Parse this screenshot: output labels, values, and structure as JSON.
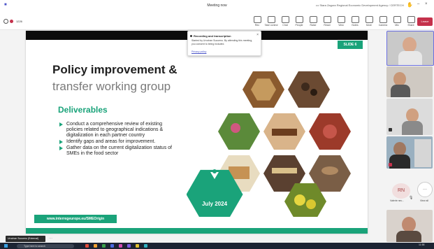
{
  "window": {
    "title": "Meeting now",
    "org": "•••  Stara Zagora Regional Economic Development Agency / CERTECH",
    "room_id": "1226"
  },
  "toolbar": {
    "buttons": [
      {
        "label": "Rec",
        "icon": "record-icon"
      },
      {
        "label": "Take control",
        "icon": "control-icon"
      },
      {
        "label": "Chat",
        "icon": "chat-icon"
      },
      {
        "label": "People",
        "icon": "people-icon"
      },
      {
        "label": "Raise",
        "icon": "raise-hand-icon"
      },
      {
        "label": "React",
        "icon": "react-icon"
      },
      {
        "label": "View",
        "icon": "view-icon"
      },
      {
        "label": "Notes",
        "icon": "notes-icon"
      },
      {
        "label": "More",
        "icon": "more-icon"
      },
      {
        "label": "Camera",
        "icon": "camera-icon"
      },
      {
        "label": "Mic",
        "icon": "mic-icon"
      },
      {
        "label": "Share",
        "icon": "share-icon"
      }
    ],
    "leave_label": "Leave"
  },
  "popup": {
    "title": "Recording and transcription",
    "body": "Started by Urochan Sucuenu. By attending this meeting, you consent to being included.",
    "link": "Privacy policy",
    "close": "×"
  },
  "slide": {
    "number": "SLIDE 6",
    "title_line1": "Policy improvement &",
    "title_line2": "transfer working group",
    "deliverables_heading": "Deliverables",
    "bullets": [
      "Conduct a comprehensive review of existing policies related to geographical indications & digitalization in each partner country",
      "Identify gaps and areas for improvement.",
      "Gather data on the current digitalization status of SMEs in the food sector"
    ],
    "date_badge": "July 2024",
    "url": "www.interregeurope.eu/SMEOrigin"
  },
  "participants": {
    "initials": "RN",
    "initials_name": "Valerie nec...",
    "view_all": "View all",
    "more": "···"
  },
  "nametag": "Urochan Sucuenu (External)",
  "taskbar": {
    "search_placeholder": "Type here to search",
    "time": "11:58"
  },
  "colors": {
    "accent_green": "#1aa37a",
    "leave_red": "#c4314b",
    "taskbar": "#1c2433"
  }
}
